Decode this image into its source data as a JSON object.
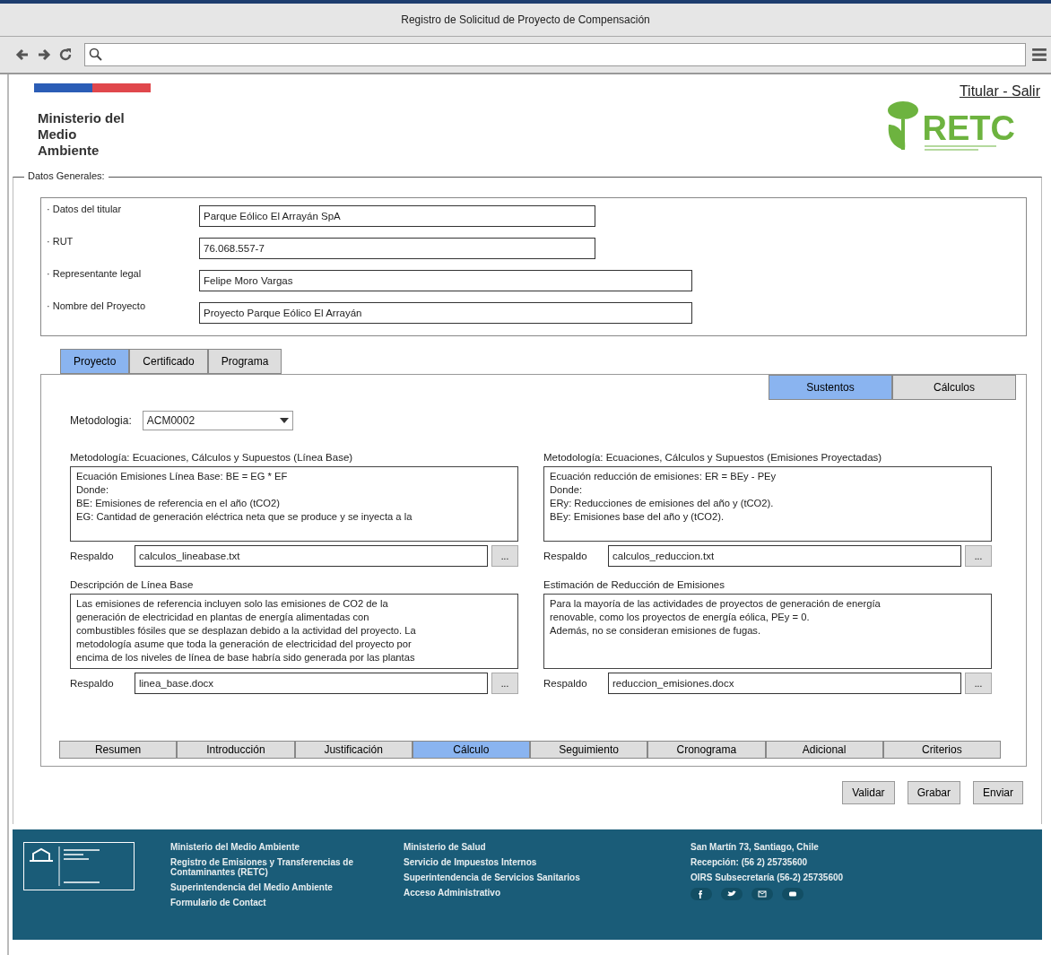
{
  "window": {
    "title": "Registro de Solicitud de Proyecto de Compensación"
  },
  "header": {
    "ministry": "Ministerio del\nMedio\nAmbiente",
    "user_link": "Titular - Salir",
    "logo_text": "RETC"
  },
  "general": {
    "legend": "Datos Generales:",
    "fields": [
      {
        "label": "· Datos del titular",
        "value": "Parque Eólico El Arrayán SpA",
        "wide": false
      },
      {
        "label": "· RUT",
        "value": "76.068.557-7",
        "wide": false
      },
      {
        "label": "· Representante legal",
        "value": "Felipe Moro Vargas",
        "wide": true
      },
      {
        "label": "· Nombre del Proyecto",
        "value": "Proyecto Parque Eólico El Arrayán",
        "wide": true
      }
    ]
  },
  "tabs": [
    {
      "label": "Proyecto",
      "selected": true
    },
    {
      "label": "Certificado",
      "selected": false
    },
    {
      "label": "Programa",
      "selected": false
    }
  ],
  "side_tabs": [
    {
      "label": "Sustentos",
      "selected": true
    },
    {
      "label": "Cálculos",
      "selected": false
    }
  ],
  "methodology": {
    "label": "Metodologia:",
    "value": "ACM0002"
  },
  "panels": [
    {
      "title": "Metodología: Ecuaciones, Cálculos y Supuestos (Línea Base)",
      "lines": [
        "Ecuación Emisiones Línea Base: BE = EG * EF",
        "Donde:",
        "BE: Emisiones de referencia en el año (tCO2)",
        "EG: Cantidad de generación eléctrica neta que se produce y se inyecta a la"
      ],
      "backup_label": "Respaldo",
      "backup_file": "calculos_lineabase.txt",
      "browse": "..."
    },
    {
      "title": "Metodología: Ecuaciones, Cálculos y Supuestos (Emisiones Proyectadas)",
      "lines": [
        "Ecuación reducción de emisiones: ER = BEy - PEy",
        "Donde:",
        "ERy: Reducciones de emisiones del año y (tCO2).",
        "BEy: Emisiones base del año y (tCO2)."
      ],
      "backup_label": "Respaldo",
      "backup_file": "calculos_reduccion.txt",
      "browse": "..."
    },
    {
      "title": "Descripción de Línea Base",
      "lines": [
        "Las emisiones de referencia incluyen solo las emisiones de CO2 de la",
        "generación de electricidad en plantas de energía alimentadas con",
        "combustibles fósiles que se desplazan debido a la actividad del proyecto. La",
        "metodología asume que toda la generación de electricidad del proyecto por",
        "encima de los niveles de línea de base habría sido generada por las plantas"
      ],
      "backup_label": "Respaldo",
      "backup_file": "linea_base.docx",
      "browse": "..."
    },
    {
      "title": "Estimación de Reducción de Emisiones",
      "lines": [
        "Para la mayoría de las actividades de proyectos de generación de energía",
        "renovable, como los proyectos de energía eólica, PEy = 0.",
        "Además, no se consideran emisiones de fugas."
      ],
      "backup_label": "Respaldo",
      "backup_file": "reduccion_emisiones.docx",
      "browse": "..."
    }
  ],
  "bottom_tabs": [
    {
      "label": "Resumen",
      "selected": false
    },
    {
      "label": "Introducción",
      "selected": false
    },
    {
      "label": "Justificación",
      "selected": false
    },
    {
      "label": "Cálculo",
      "selected": true
    },
    {
      "label": "Seguimiento",
      "selected": false
    },
    {
      "label": "Cronograma",
      "selected": false
    },
    {
      "label": "Adicional",
      "selected": false
    },
    {
      "label": "Criterios",
      "selected": false
    }
  ],
  "buttons": [
    "Validar",
    "Grabar",
    "Enviar"
  ],
  "footer": {
    "columns": [
      [
        "Ministerio del Medio Ambiente",
        "Registro de Emisiones y Transferencias de Contaminantes (RETC)",
        "Superintendencia del Medio Ambiente",
        "Formulario de Contact"
      ],
      [
        "Ministerio de Salud",
        "Servicio de Impuestos Internos",
        "Superintendencia de Servicios Sanitarios",
        "Acceso Administrativo"
      ]
    ],
    "contact": [
      "San Martín 73, Santiago, Chile",
      "Recepción: (56 2) 25735600",
      "OIRS Subsecretaría (56-2) 25735600"
    ],
    "social": [
      {
        "kind": "facebook"
      },
      {
        "kind": "twitter"
      },
      {
        "kind": "mail"
      },
      {
        "kind": "youtube"
      }
    ]
  }
}
